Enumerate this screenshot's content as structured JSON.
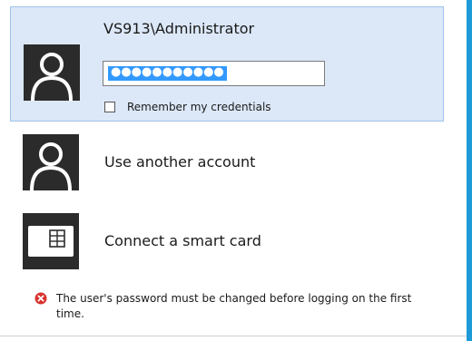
{
  "selected_account": {
    "name": "VS913\\Administrator",
    "avatar_icon": "user-avatar-icon",
    "password": {
      "masked_value": "●●●●●●●●●●●",
      "selected": true,
      "selection_color": "#3399ff"
    },
    "remember_credentials": {
      "label": "Remember my credentials",
      "checked": false
    }
  },
  "options": [
    {
      "label": "Use another account",
      "icon": "user-avatar-icon"
    },
    {
      "label": "Connect a smart card",
      "icon": "smart-card-icon"
    }
  ],
  "error": {
    "icon": "error-icon",
    "message": "The user's password must be changed before logging on the first time."
  },
  "colors": {
    "card_background": "#dce8f8",
    "card_border": "#9ec3ea",
    "avatar_background": "#2b2b2b",
    "accent": "#1e9bd7",
    "error_red": "#d8322e"
  }
}
